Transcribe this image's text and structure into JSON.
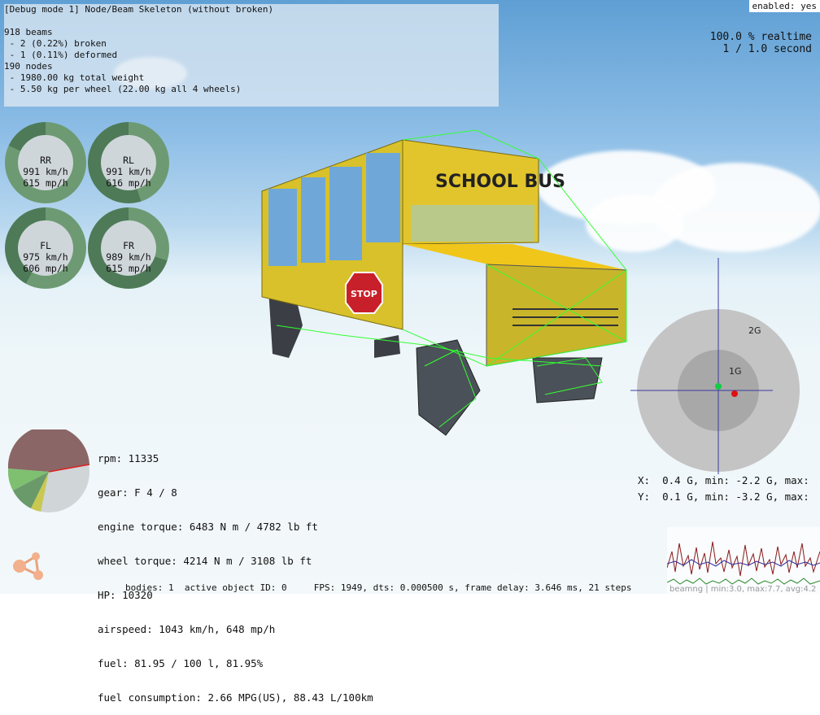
{
  "debug_panel": {
    "title": "[Debug mode 1] Node/Beam Skeleton (without broken)",
    "lines": [
      "918 beams",
      " - 2 (0.22%) broken",
      " - 1 (0.11%) deformed",
      "190 nodes",
      " - 1980.00 kg total weight",
      " - 5.50 kg per wheel (22.00 kg all 4 wheels)"
    ]
  },
  "enabled_label": "enabled: yes",
  "realtime": {
    "line1": "100.0 % realtime",
    "line2": "1 / 1.0 second"
  },
  "wheels": [
    {
      "name": "RR",
      "kmh": "991 km/h",
      "mph": "615 mp/h",
      "fill": 0.82
    },
    {
      "name": "RL",
      "kmh": "991 km/h",
      "mph": "616 mp/h",
      "fill": 0.45
    },
    {
      "name": "FL",
      "kmh": "975 km/h",
      "mph": "606 mp/h",
      "fill": 0.58
    },
    {
      "name": "FR",
      "kmh": "989 km/h",
      "mph": "615 mp/h",
      "fill": 0.3
    }
  ],
  "bus_sign": "SCHOOL BUS",
  "stop_sign": "STOP",
  "engine_stats": [
    "rpm: 11335",
    "gear: F 4 / 8",
    "engine torque: 6483 N m / 4782 lb ft",
    "wheel torque: 4214 N m / 3108 lb ft",
    "HP: 10320",
    "airspeed: 1043 km/h, 648 mp/h",
    "fuel: 81.95 / 100 l, 81.95%",
    "fuel consumption: 2.66 MPG(US), 88.43 L/100km"
  ],
  "gmeter": {
    "label_2g": "2G",
    "label_1g": "1G",
    "x_line": "X:  0.4 G, min: -2.2 G, max:",
    "y_line": "Y:  0.1 G, min: -3.2 G, max:"
  },
  "bottom_bar": "bodies: 1  active object ID: 0     FPS: 1949, dts: 0.000500 s, frame delay: 3.646 ms, 21 steps",
  "graph_caption": "beamng | min:3.0, max:7.7, avg:4.2",
  "colors": {
    "gauge_ring": "#4e7a57",
    "wheel_fill": "#6d9a72",
    "skeleton": "#33ff33"
  }
}
